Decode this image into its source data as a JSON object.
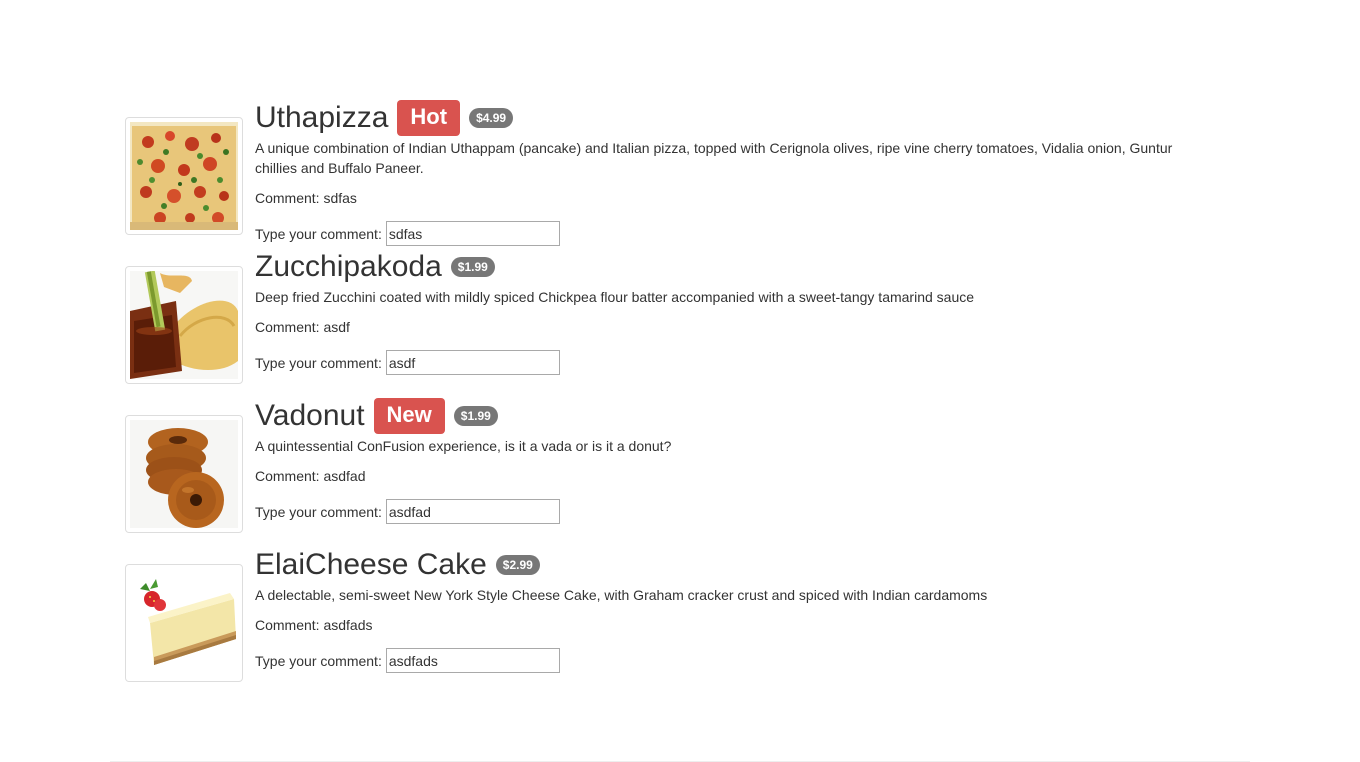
{
  "dishes": [
    {
      "name": "Uthapizza",
      "label": "Hot",
      "price": "$4.99",
      "description": "A unique combination of Indian Uthappam (pancake) and Italian pizza, topped with Cerignola olives, ripe vine cherry tomatoes, Vidalia onion, Guntur chillies and Buffalo Paneer.",
      "comment_text": "Comment: sdfas",
      "comment_prompt": "Type your comment:",
      "comment_value": "sdfas"
    },
    {
      "name": "Zucchipakoda",
      "label": "",
      "price": "$1.99",
      "description": "Deep fried Zucchini coated with mildly spiced Chickpea flour batter accompanied with a sweet-tangy tamarind sauce",
      "comment_text": "Comment: asdf",
      "comment_prompt": "Type your comment:",
      "comment_value": "asdf"
    },
    {
      "name": "Vadonut",
      "label": "New",
      "price": "$1.99",
      "description": "A quintessential ConFusion experience, is it a vada or is it a donut?",
      "comment_text": "Comment: asdfad",
      "comment_prompt": "Type your comment:",
      "comment_value": "asdfad"
    },
    {
      "name": "ElaiCheese Cake",
      "label": "",
      "price": "$2.99",
      "description": "A delectable, semi-sweet New York Style Cheese Cake, with Graham cracker crust and spiced with Indian cardamoms",
      "comment_text": "Comment: asdfads",
      "comment_prompt": "Type your comment:",
      "comment_value": "asdfads"
    }
  ],
  "colors": {
    "label_badge": "#d9534f",
    "price_badge": "#777777",
    "text": "#333333"
  }
}
